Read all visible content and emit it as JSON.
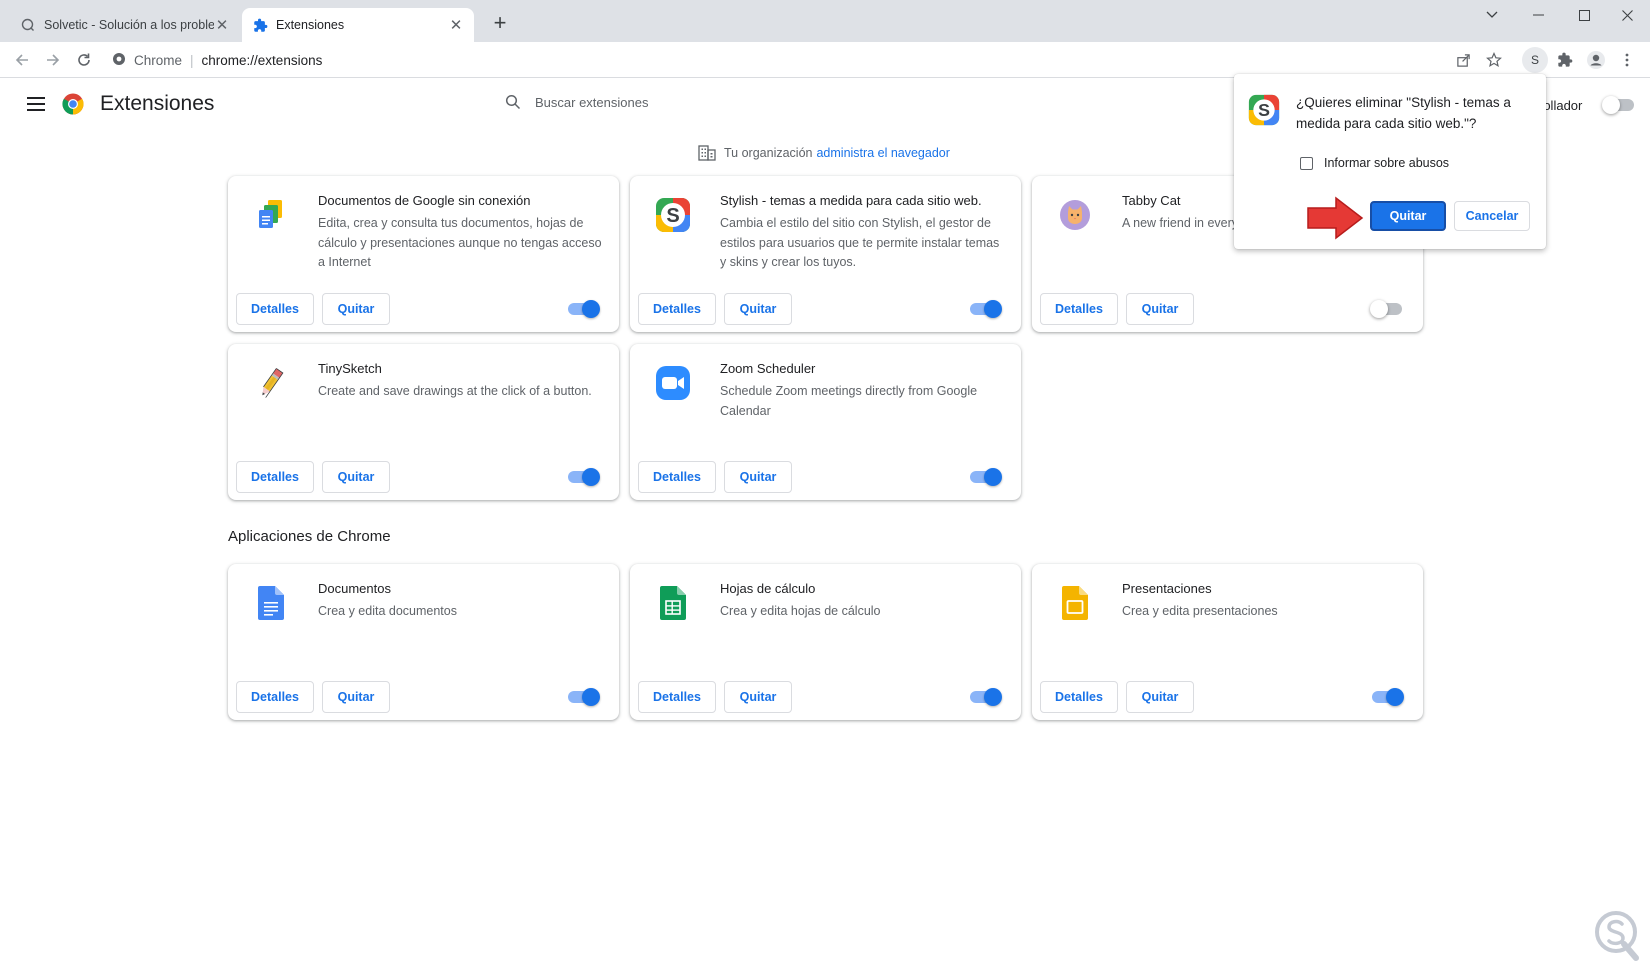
{
  "tabs": [
    {
      "title": "Solvetic - Solución a los problemas",
      "active": false
    },
    {
      "title": "Extensiones",
      "active": true
    }
  ],
  "window_controls": [
    "chevron-down",
    "minimize",
    "maximize",
    "close"
  ],
  "toolbar": {
    "site_label": "Chrome",
    "url": "chrome://extensions",
    "profile_letter": "S"
  },
  "page": {
    "title": "Extensiones",
    "search_placeholder": "Buscar extensiones",
    "dev_mode_label": "rollador",
    "dev_mode_on": false,
    "org_notice": "Tu organización",
    "org_link": "administra el navegador"
  },
  "extensions": [
    {
      "name": "Documentos de Google sin conexión",
      "desc": "Edita, crea y consulta tus documentos, hojas de cálculo y presentaciones aunque no tengas acceso a Internet",
      "details": "Detalles",
      "remove": "Quitar",
      "enabled": true,
      "icon": "docs-offline-icon"
    },
    {
      "name": "Stylish - temas a medida para cada sitio web.",
      "desc": "Cambia el estilo del sitio con Stylish, el gestor de estilos para usuarios que te permite instalar temas y skins y crear los tuyos.",
      "details": "Detalles",
      "remove": "Quitar",
      "enabled": true,
      "icon": "stylish-icon"
    },
    {
      "name": "Tabby Cat",
      "desc": "A new friend in every",
      "details": "Detalles",
      "remove": "Quitar",
      "enabled": false,
      "icon": "tabby-cat-icon"
    },
    {
      "name": "TinySketch",
      "desc": "Create and save drawings at the click of a button.",
      "details": "Detalles",
      "remove": "Quitar",
      "enabled": true,
      "icon": "pencil-icon"
    },
    {
      "name": "Zoom Scheduler",
      "desc": "Schedule Zoom meetings directly from Google Calendar",
      "details": "Detalles",
      "remove": "Quitar",
      "enabled": true,
      "icon": "zoom-icon"
    }
  ],
  "apps_section": {
    "title": "Aplicaciones de Chrome",
    "items": [
      {
        "name": "Documentos",
        "desc": "Crea y edita documentos",
        "details": "Detalles",
        "remove": "Quitar",
        "enabled": true,
        "icon": "docs-icon"
      },
      {
        "name": "Hojas de cálculo",
        "desc": "Crea y edita hojas de cálculo",
        "details": "Detalles",
        "remove": "Quitar",
        "enabled": true,
        "icon": "sheets-icon"
      },
      {
        "name": "Presentaciones",
        "desc": "Crea y edita presentaciones",
        "details": "Detalles",
        "remove": "Quitar",
        "enabled": true,
        "icon": "slides-icon"
      }
    ]
  },
  "dialog": {
    "title": "¿Quieres eliminar \"Stylish - temas a medida para cada sitio web.\"?",
    "checkbox_label": "Informar sobre abusos",
    "checkbox_checked": false,
    "confirm": "Quitar",
    "cancel": "Cancelar"
  },
  "colors": {
    "accent": "#1a73e8",
    "tabstrip": "#dee1e6",
    "arrow": "#e53935"
  }
}
